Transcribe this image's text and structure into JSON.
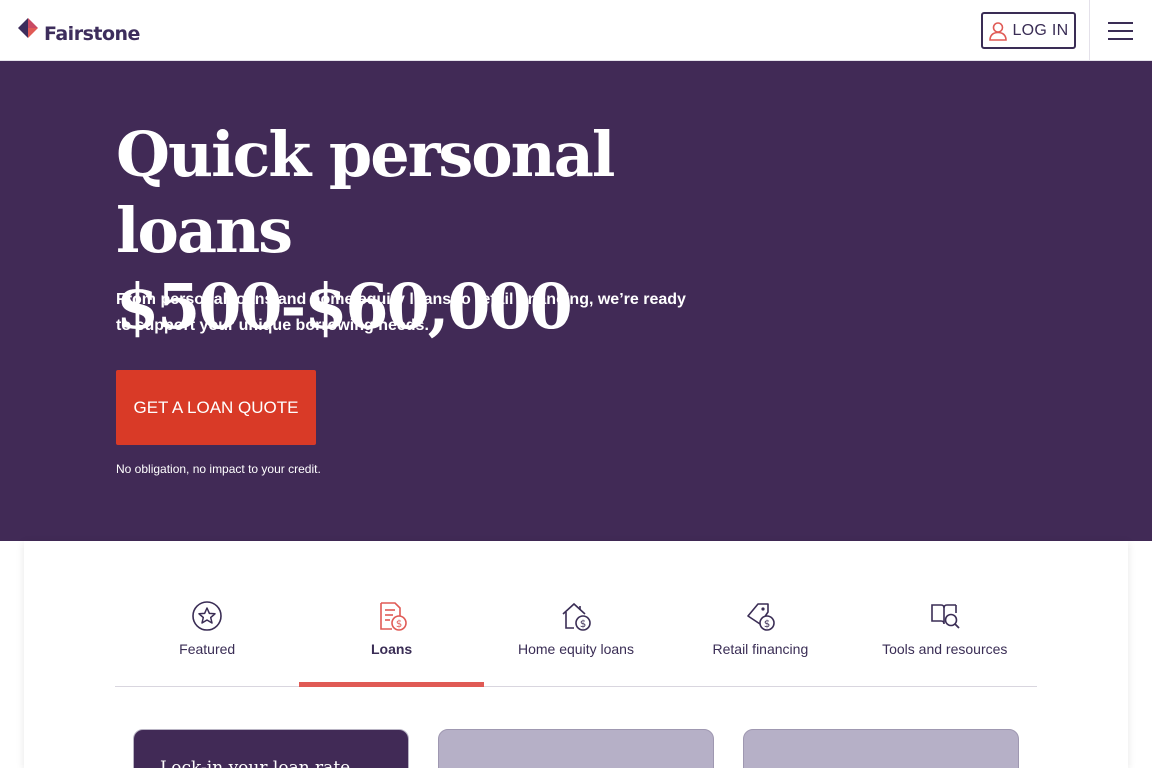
{
  "brand": {
    "name": "Fairstone",
    "colors": {
      "purple": "#412a56",
      "red": "#d93a27",
      "tab_underline": "#e05a55"
    }
  },
  "header": {
    "login_label": "LOG IN",
    "login_icon": "user-icon",
    "menu_icon": "hamburger-menu-icon"
  },
  "hero": {
    "title_line1": "Quick personal loans",
    "title_line2": "$500-$60,000",
    "subtitle": "From personal loans and home equity loans to retail financing, we’re ready to support your unique borrowing needs.",
    "cta_label": "GET A LOAN QUOTE",
    "disclaimer": "No obligation, no impact to your credit."
  },
  "tabs": {
    "active": "Loans",
    "items": [
      {
        "label": "Featured",
        "icon": "star-badge-icon"
      },
      {
        "label": "Loans",
        "icon": "document-dollar-icon"
      },
      {
        "label": "Home equity loans",
        "icon": "house-dollar-icon"
      },
      {
        "label": "Retail financing",
        "icon": "tag-dollar-icon"
      },
      {
        "label": "Tools and resources",
        "icon": "book-search-icon"
      }
    ]
  },
  "tiles": {
    "tile1_text": "Lock-in  your  loan  rate"
  }
}
